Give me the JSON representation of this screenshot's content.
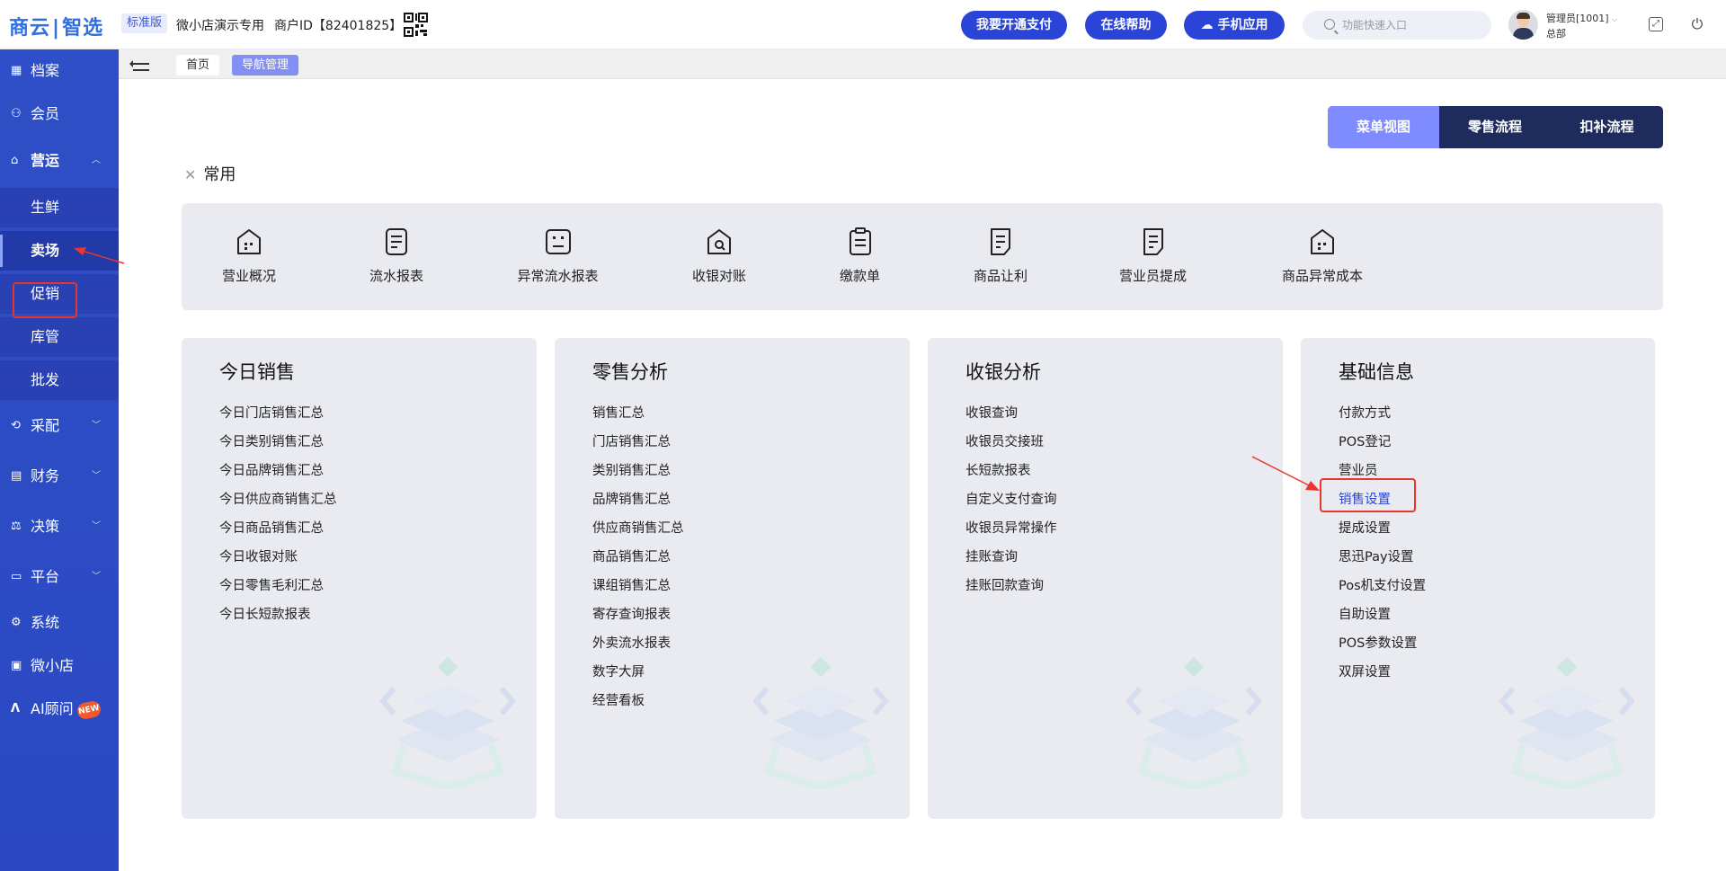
{
  "header": {
    "logo_left": "商云",
    "logo_right": "智选",
    "edition": "标准版",
    "store_name": "微小店演示专用",
    "merchant_id": "商户ID【82401825】",
    "btn_pay": "我要开通支付",
    "btn_help": "在线帮助",
    "btn_mobile": "手机应用",
    "search_placeholder": "功能快速入口",
    "user_name": "管理员[1001]",
    "user_dept": "总部"
  },
  "sidebar": {
    "items": [
      {
        "label": "档案",
        "icon": "archive-icon"
      },
      {
        "label": "会员",
        "icon": "member-icon"
      },
      {
        "label": "营运",
        "icon": "store-icon",
        "expanded": true
      },
      {
        "label": "采配",
        "icon": "purchase-icon"
      },
      {
        "label": "财务",
        "icon": "finance-icon"
      },
      {
        "label": "决策",
        "icon": "decision-icon"
      },
      {
        "label": "平台",
        "icon": "platform-icon"
      },
      {
        "label": "系统",
        "icon": "system-icon"
      },
      {
        "label": "微小店",
        "icon": "shop-icon"
      },
      {
        "label": "AI顾问",
        "icon": "ai-icon",
        "badge": "NEW"
      }
    ],
    "subitems": [
      "生鲜",
      "卖场",
      "促销",
      "库管",
      "批发"
    ],
    "active_subitem": "卖场"
  },
  "tabs": {
    "home": "首页",
    "nav": "导航管理"
  },
  "view_toggle": {
    "menu_view": "菜单视图",
    "retail_flow": "零售流程",
    "deduct_flow": "扣补流程",
    "active": "菜单视图"
  },
  "common": {
    "title": "常用",
    "items": [
      {
        "label": "营业概况",
        "icon": "store-chart-icon"
      },
      {
        "label": "流水报表",
        "icon": "report-icon"
      },
      {
        "label": "异常流水报表",
        "icon": "abnormal-report-icon"
      },
      {
        "label": "收银对账",
        "icon": "reconcile-icon"
      },
      {
        "label": "缴款单",
        "icon": "clipboard-icon"
      },
      {
        "label": "商品让利",
        "icon": "discount-doc-icon"
      },
      {
        "label": "营业员提成",
        "icon": "commission-doc-icon"
      },
      {
        "label": "商品异常成本",
        "icon": "cost-icon"
      }
    ]
  },
  "cards": [
    {
      "title": "今日销售",
      "items": [
        "今日门店销售汇总",
        "今日类别销售汇总",
        "今日品牌销售汇总",
        "今日供应商销售汇总",
        "今日商品销售汇总",
        "今日收银对账",
        "今日零售毛利汇总",
        "今日长短款报表"
      ]
    },
    {
      "title": "零售分析",
      "items": [
        "销售汇总",
        "门店销售汇总",
        "类别销售汇总",
        "品牌销售汇总",
        "供应商销售汇总",
        "商品销售汇总",
        "课组销售汇总",
        "寄存查询报表",
        "外卖流水报表",
        "数字大屏",
        "经营看板"
      ]
    },
    {
      "title": "收银分析",
      "items": [
        "收银查询",
        "收银员交接班",
        "长短款报表",
        "自定义支付查询",
        "收银员异常操作",
        "挂账查询",
        "挂账回款查询"
      ]
    },
    {
      "title": "基础信息",
      "items": [
        "付款方式",
        "POS登记",
        "营业员",
        "销售设置",
        "提成设置",
        "思迅Pay设置",
        "Pos机支付设置",
        "自助设置",
        "POS参数设置",
        "双屏设置"
      ]
    }
  ],
  "colors": {
    "brand": "#2a44d8",
    "sidebar": "#2e4fc7",
    "highlight": "#e8362c",
    "toggle_dark": "#1d2c5c",
    "toggle_active": "#7f8cff"
  }
}
